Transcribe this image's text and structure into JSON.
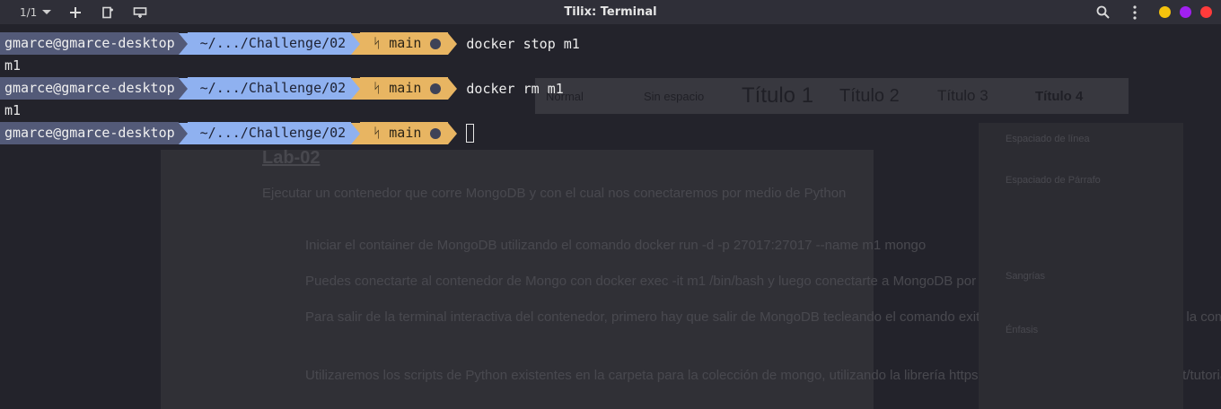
{
  "titlebar": {
    "session_counter": "1/1",
    "title": "Tilix: Terminal",
    "dot_colors": [
      "#f4c20d",
      "#a020f0",
      "#ff3b3b"
    ]
  },
  "prompt": {
    "user_host": "gmarce@gmarce-desktop",
    "path": "~/.../Challenge/02",
    "branch_icon": "ᛋ",
    "branch": "main"
  },
  "terminal": {
    "lines": [
      {
        "command": "docker stop m1",
        "output": "m1"
      },
      {
        "command": "docker rm m1",
        "output": "m1"
      },
      {
        "command": "",
        "output": ""
      }
    ]
  },
  "background_ghost": {
    "styles": [
      "Normal",
      "Sin espacio",
      "Título 1",
      "Título 2",
      "Título 3",
      "Título 4"
    ],
    "heading": "Lab-02",
    "paragraph": "Ejecutar un contenedor que corre MongoDB y con el cual nos conectaremos por medio de Python",
    "items": [
      "Iniciar el container de MongoDB utilizando el comando docker run -d -p 27017:27017 --name m1 mongo",
      "Puedes conectarte al contenedor de Mongo con docker exec -it m1 /bin/bash y luego conectarte a MongoDB por medio del comando mongosh",
      "Para salir de la terminal interactiva del contenedor, primero hay que salir de MongoDB tecleando el comando exit, y una vez fuera podemos teclear la combinación Ctrl+P y Ctrl+Q para salir",
      "Utilizaremos los scripts de Python existentes en la carpeta para la colección de mongo, utilizando la librería https://api.mongodb.com/python/current/tutorial.html"
    ],
    "sidebar_labels": [
      "Espaciado de línea",
      "Espaciado de Párrafo",
      "Sangrías",
      "Énfasis"
    ]
  },
  "colors": {
    "segment_user": "#535a78",
    "segment_path": "#8fb1f0",
    "segment_git": "#e8b562",
    "background": "#23232b"
  }
}
